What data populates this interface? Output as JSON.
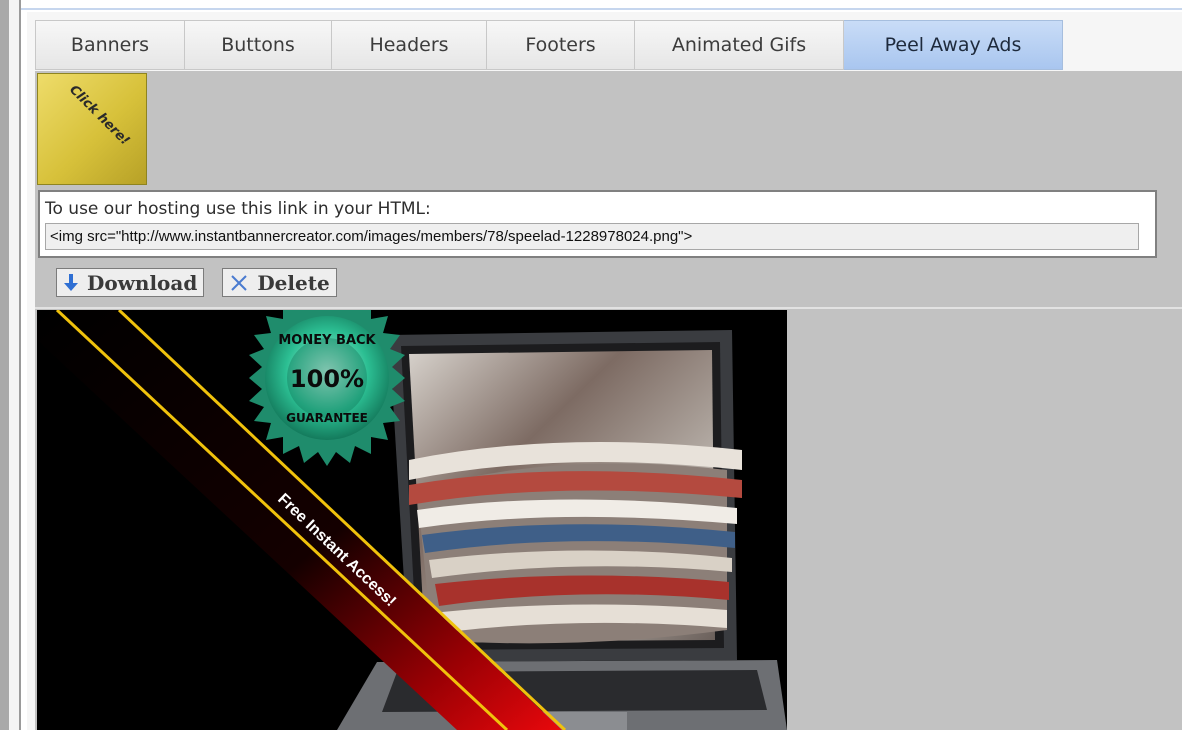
{
  "tabs": [
    {
      "label": "Banners",
      "active": false
    },
    {
      "label": "Buttons",
      "active": false
    },
    {
      "label": "Headers",
      "active": false
    },
    {
      "label": "Footers",
      "active": false
    },
    {
      "label": "Animated Gifs",
      "active": false
    },
    {
      "label": "Peel Away Ads",
      "active": true
    }
  ],
  "thumbnail": {
    "text": "Click here!"
  },
  "hosting": {
    "label": "To use our hosting use this link in your HTML:",
    "code": "<img src=\"http://www.instantbannercreator.com/images/members/78/speelad-1228978024.png\">"
  },
  "actions": {
    "download_label": "Download",
    "delete_label": "Delete"
  },
  "preview": {
    "badge_top": "MONEY BACK",
    "badge_percent": "100%",
    "badge_bottom": "GUARANTEE",
    "ribbon_text": "Free Instant Access!"
  },
  "colors": {
    "active_tab": "#b4cdf2",
    "panel": "#c2c2c2",
    "ribbon_red": "#c8060a",
    "ribbon_gold": "#f0c20c",
    "badge_green": "#2bb08a"
  },
  "icons": {
    "download": "arrow-down-icon",
    "delete": "x-icon"
  }
}
